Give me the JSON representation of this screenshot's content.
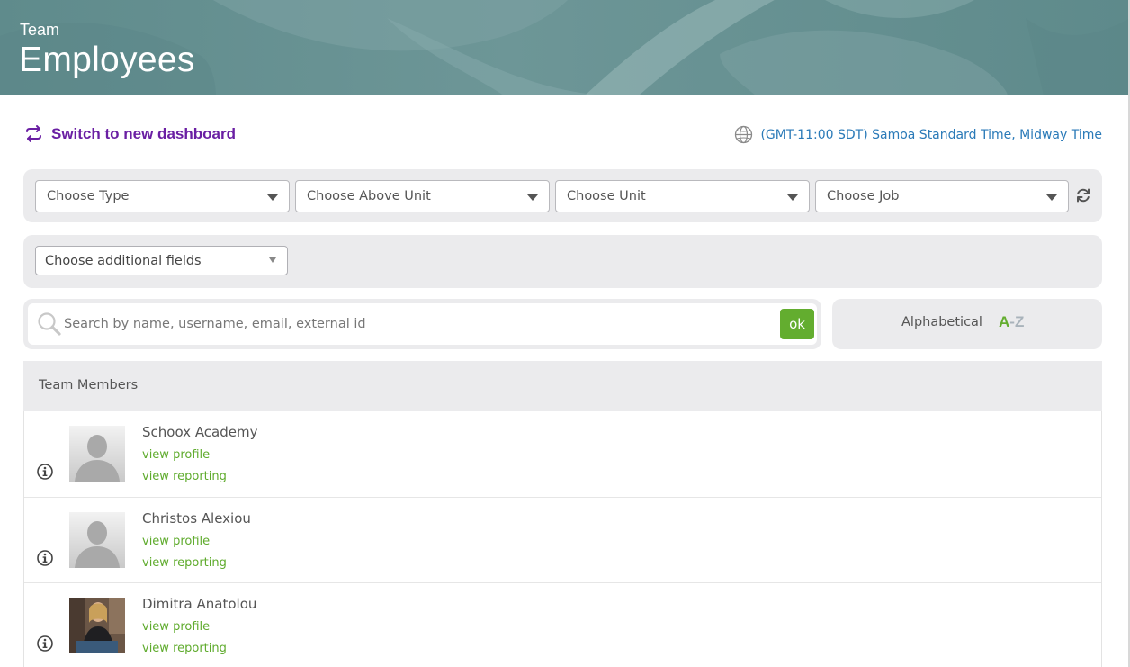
{
  "header": {
    "subtitle": "Team",
    "title": "Employees"
  },
  "switch_dashboard": {
    "label": "Switch to new dashboard",
    "icon": "swap-arrows-icon",
    "color": "#6a1fa3"
  },
  "timezone": {
    "icon": "globe-icon",
    "label": "(GMT-11:00 SDT) Samoa Standard Time, Midway Time"
  },
  "filters": {
    "type": "Choose Type",
    "above_unit": "Choose Above Unit",
    "unit": "Choose Unit",
    "job": "Choose Job",
    "refresh_icon": "refresh-icon",
    "additional_fields": "Choose additional fields"
  },
  "search": {
    "placeholder": "Search by name, username, email, external id",
    "button": "ok",
    "icon": "search-icon"
  },
  "sort": {
    "label": "Alphabetical",
    "a": "A",
    "dash": "-",
    "z": "Z"
  },
  "members": {
    "heading": "Team Members",
    "list": [
      {
        "name": "Schoox Academy",
        "view_profile": "view profile",
        "view_reporting": "view reporting",
        "avatar": "default-avatar"
      },
      {
        "name": "Christos Alexiou",
        "view_profile": "view profile",
        "view_reporting": "view reporting",
        "avatar": "default-avatar"
      },
      {
        "name": "Dimitra Anatolou",
        "view_profile": "view profile",
        "view_reporting": "view reporting",
        "avatar": "photo-avatar"
      }
    ]
  },
  "colors": {
    "accent_green": "#63ad2f",
    "link_blue": "#2a7ab8",
    "panel_gray": "#ebebed"
  }
}
